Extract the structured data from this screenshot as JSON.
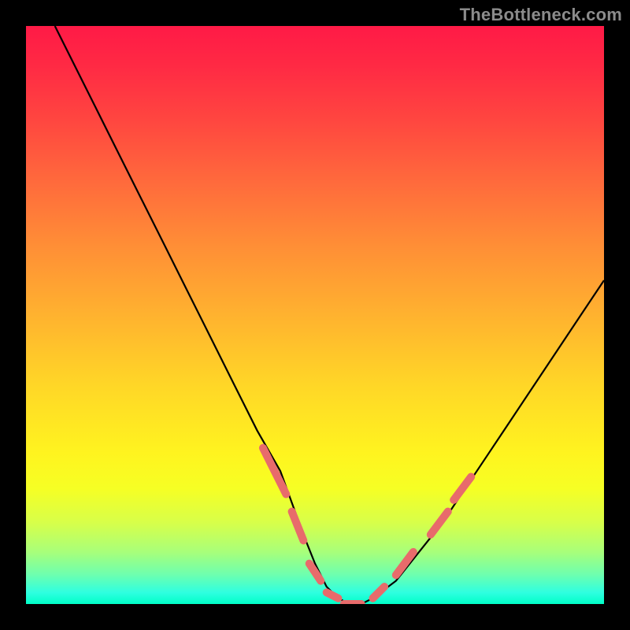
{
  "watermark": "TheBottleneck.com",
  "colors": {
    "page_bg": "#000000",
    "curve": "#000000",
    "dash": "#e86b6b"
  },
  "chart_data": {
    "type": "line",
    "title": "",
    "xlabel": "",
    "ylabel": "",
    "xlim": [
      0,
      100
    ],
    "ylim": [
      0,
      100
    ],
    "series": [
      {
        "name": "curve",
        "x": [
          5,
          8,
          12,
          16,
          20,
          24,
          28,
          32,
          36,
          40,
          44,
          48,
          50,
          52,
          54,
          56,
          58,
          60,
          64,
          68,
          72,
          76,
          80,
          84,
          88,
          92,
          96,
          100
        ],
        "y": [
          100,
          94,
          86,
          78,
          70,
          62,
          54,
          46,
          38,
          30,
          23,
          12,
          7,
          3,
          1,
          0,
          0,
          1,
          4,
          9,
          14,
          20,
          26,
          32,
          38,
          44,
          50,
          56
        ]
      }
    ],
    "dash_segments": [
      {
        "x0": 41,
        "y0": 27,
        "x1": 45,
        "y1": 19
      },
      {
        "x0": 46,
        "y0": 16,
        "x1": 48,
        "y1": 11
      },
      {
        "x0": 49,
        "y0": 7,
        "x1": 51,
        "y1": 4
      },
      {
        "x0": 52,
        "y0": 2,
        "x1": 54,
        "y1": 1
      },
      {
        "x0": 55,
        "y0": 0,
        "x1": 58,
        "y1": 0
      },
      {
        "x0": 60,
        "y0": 1,
        "x1": 62,
        "y1": 3
      },
      {
        "x0": 64,
        "y0": 5,
        "x1": 67,
        "y1": 9
      },
      {
        "x0": 70,
        "y0": 12,
        "x1": 73,
        "y1": 16
      },
      {
        "x0": 74,
        "y0": 18,
        "x1": 77,
        "y1": 22
      }
    ]
  }
}
